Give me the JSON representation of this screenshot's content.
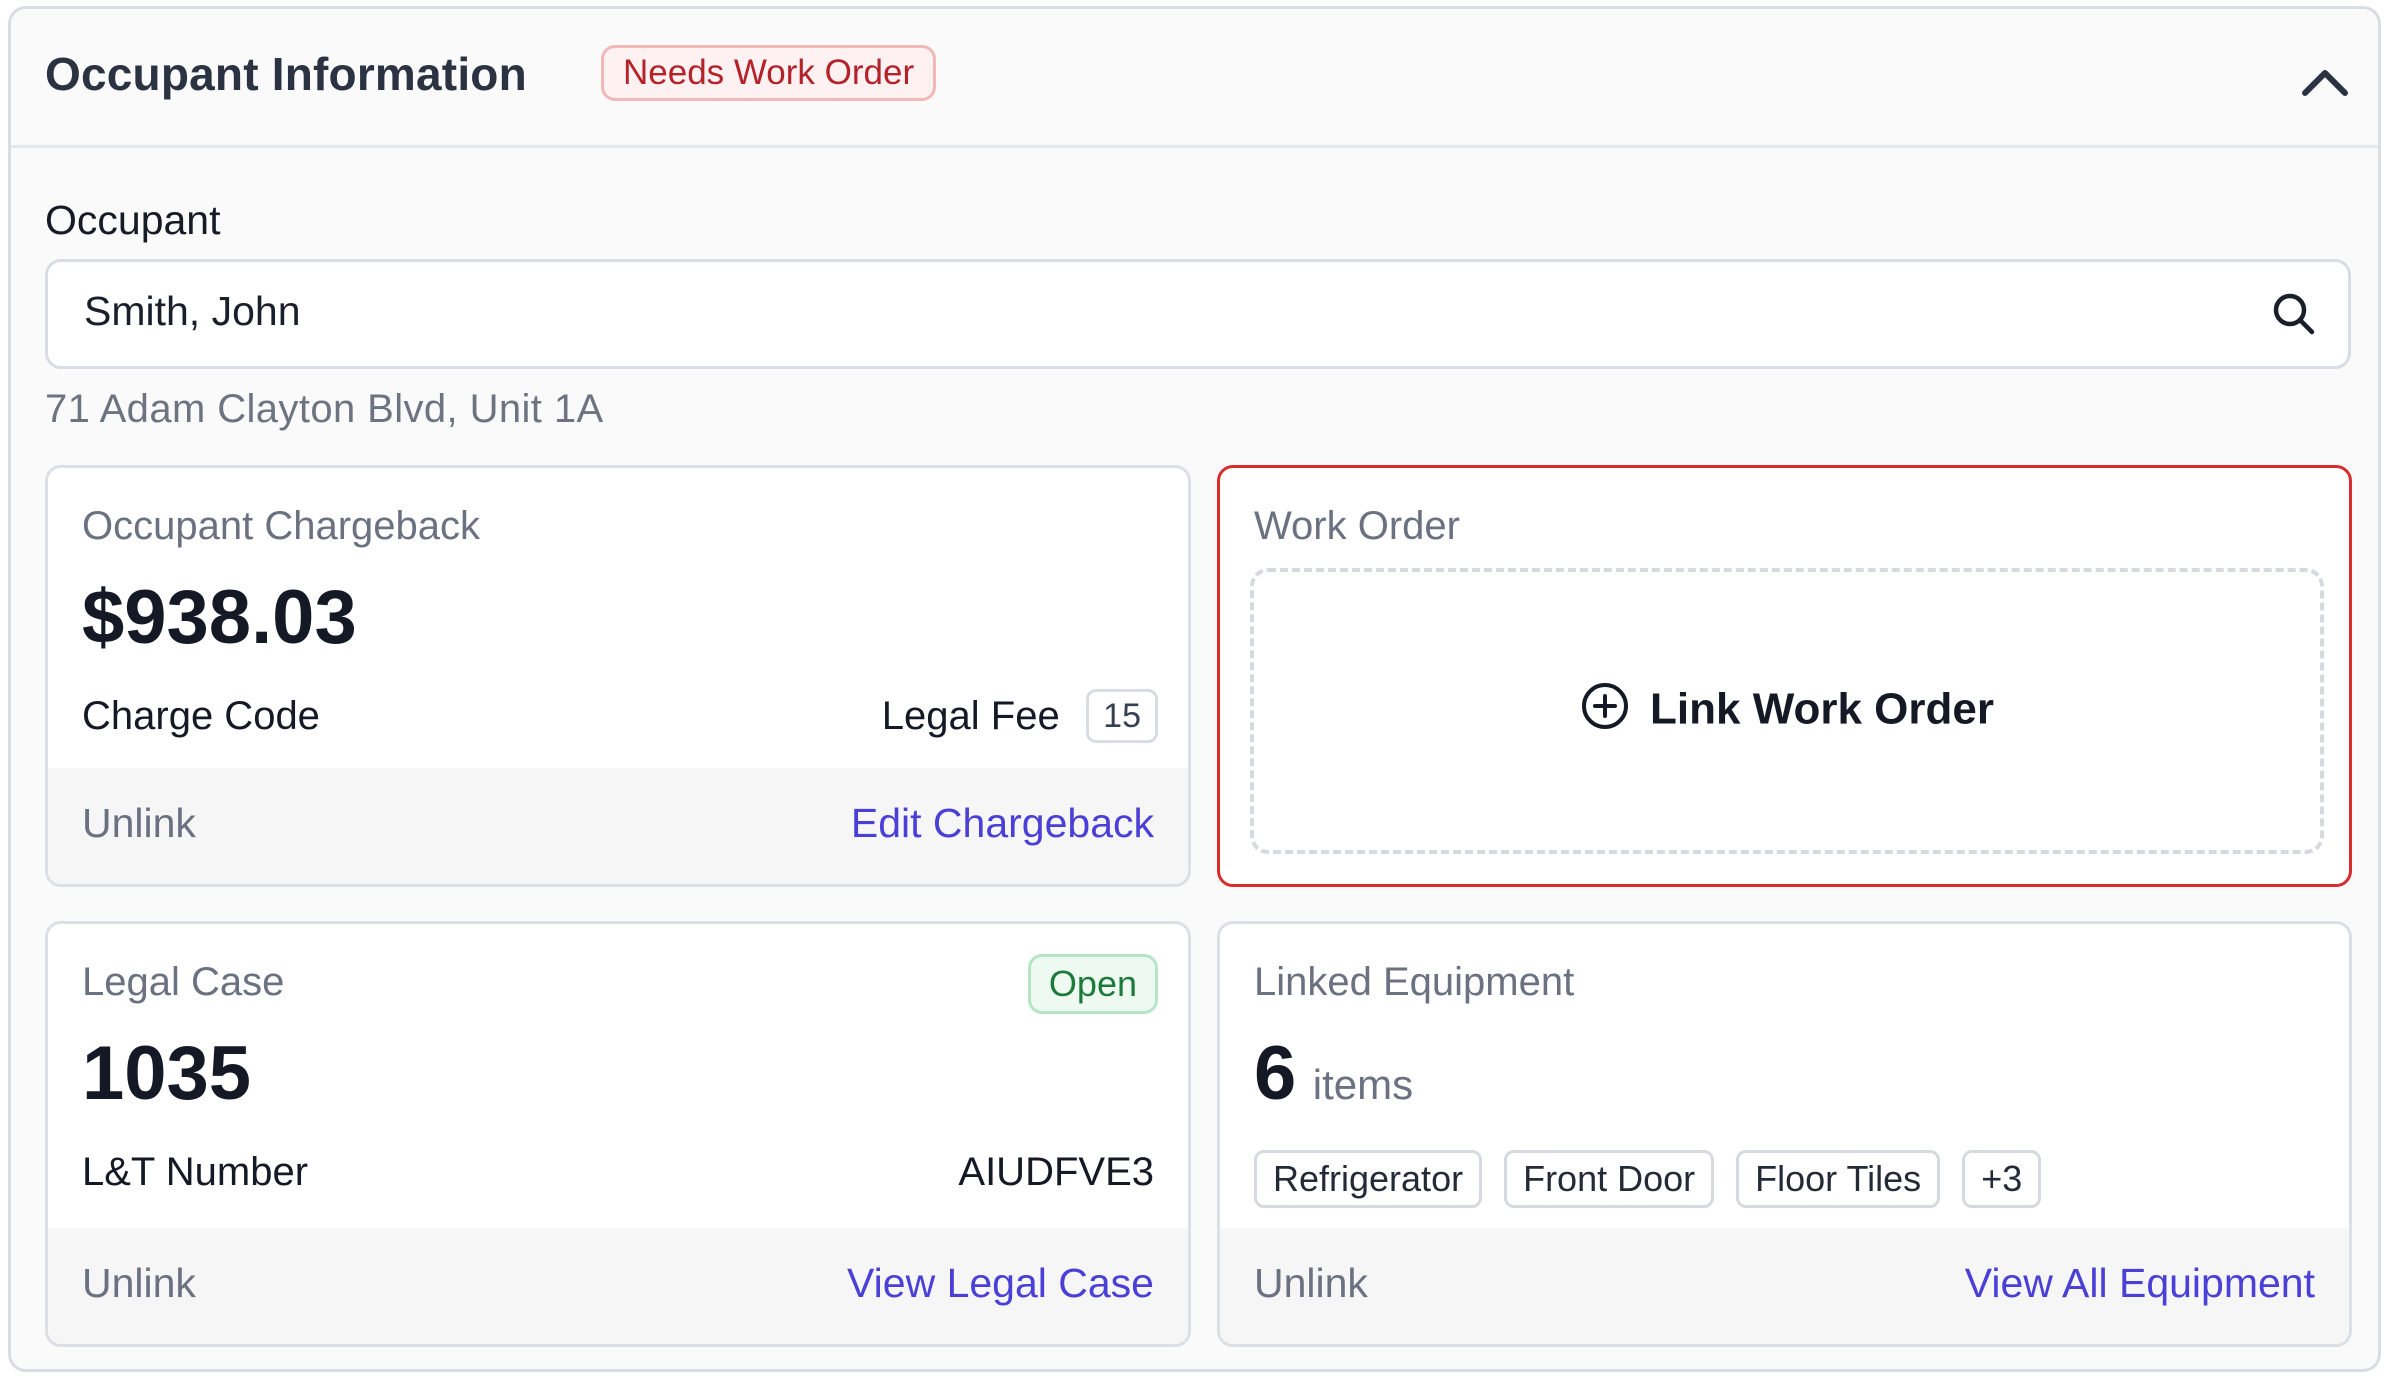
{
  "header": {
    "title": "Occupant Information",
    "status_badge": "Needs Work Order",
    "collapse_icon": "chevron-up-icon"
  },
  "occupant": {
    "label": "Occupant",
    "value": "Smith, John",
    "search_icon": "search-icon",
    "address": "71 Adam Clayton Blvd, Unit 1A"
  },
  "chargeback": {
    "title": "Occupant Chargeback",
    "amount": "$938.03",
    "charge_code_label": "Charge Code",
    "charge_code_value": "Legal Fee",
    "charge_code_number": "15",
    "unlink_label": "Unlink",
    "action_label": "Edit Chargeback"
  },
  "work_order": {
    "title": "Work Order",
    "link_label": "Link Work Order",
    "link_icon": "plus-circle-icon",
    "border_color": "#d92d2d"
  },
  "legal_case": {
    "title": "Legal Case",
    "status": "Open",
    "case_number": "1035",
    "lt_label": "L&T Number",
    "lt_value": "AIUDFVE3",
    "unlink_label": "Unlink",
    "action_label": "View Legal Case"
  },
  "equipment": {
    "title": "Linked Equipment",
    "count": "6",
    "count_unit": "items",
    "tags": [
      "Refrigerator",
      "Front Door",
      "Floor Tiles",
      "+3"
    ],
    "unlink_label": "Unlink",
    "action_label": "View All Equipment"
  },
  "colors": {
    "accent_link": "#4a3fd6",
    "danger": "#b4232a",
    "success": "#1c7a3a"
  }
}
